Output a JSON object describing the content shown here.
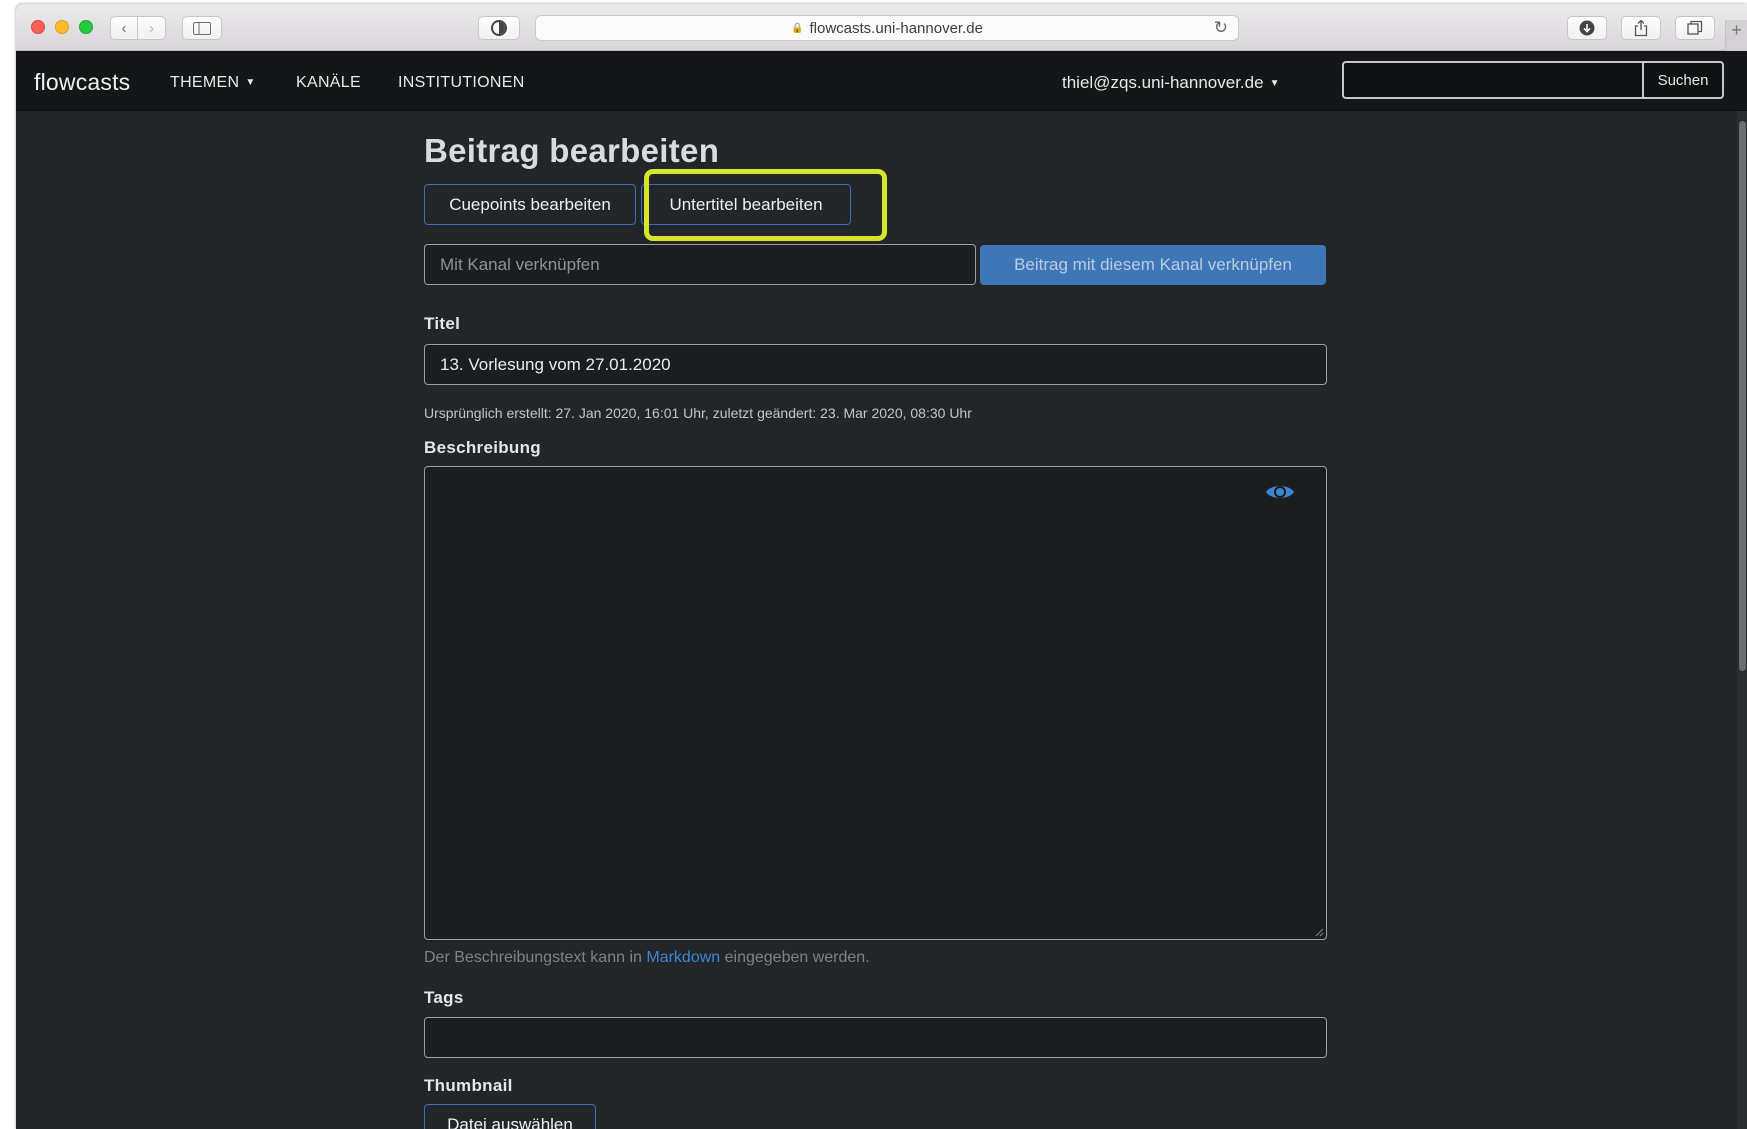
{
  "browser": {
    "url": "flowcasts.uni-hannover.de"
  },
  "navbar": {
    "brand": "flowcasts",
    "items": [
      {
        "label": "THEMEN"
      },
      {
        "label": "KANÄLE"
      },
      {
        "label": "INSTITUTIONEN"
      }
    ],
    "user": "thiel@zqs.uni-hannover.de",
    "search_button": "Suchen"
  },
  "page": {
    "title": "Beitrag bearbeiten",
    "cuepoints_button": "Cuepoints bearbeiten",
    "subtitles_button": "Untertitel bearbeiten",
    "channel_placeholder": "Mit Kanal verknüpfen",
    "channel_button": "Beitrag mit diesem Kanal verknüpfen",
    "title_label": "Titel",
    "title_value": "13. Vorlesung vom 27.01.2020",
    "meta": "Ursprünglich erstellt: 27. Jan 2020, 16:01 Uhr, zuletzt geändert: 23. Mar 2020, 08:30 Uhr",
    "description_label": "Beschreibung",
    "help_before": "Der Beschreibungstext kann in",
    "help_link": "Markdown",
    "help_after": "eingegeben werden.",
    "tags_label": "Tags",
    "thumbnail_label": "Thumbnail",
    "file_button": "Datei auswählen"
  },
  "colors": {
    "highlight": "#d7e42c",
    "accent": "#3f76b8",
    "link": "#3c85d4"
  }
}
